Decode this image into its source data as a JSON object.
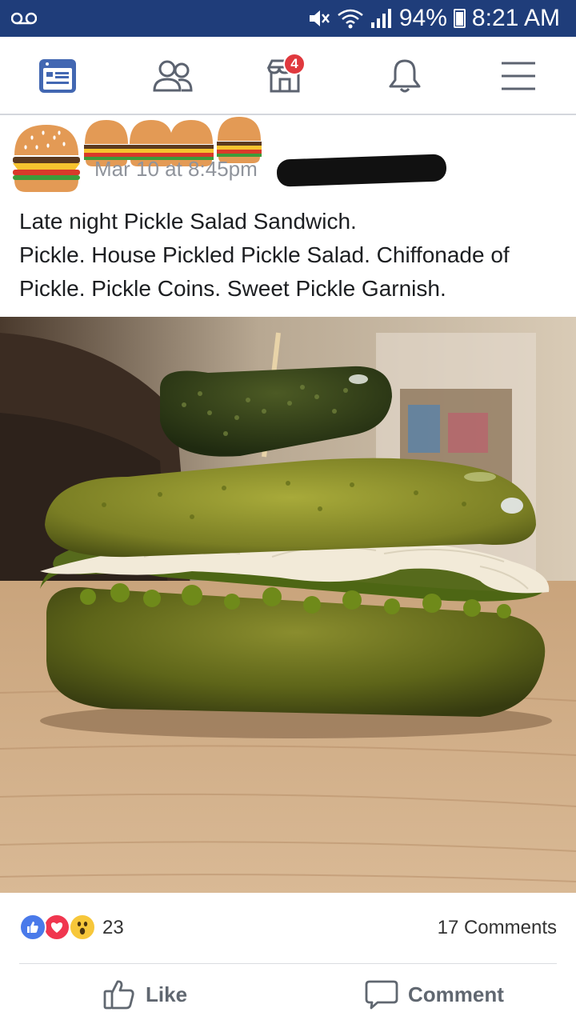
{
  "status_bar": {
    "battery_percent": "94%",
    "time": "8:21 AM"
  },
  "nav": {
    "items": [
      "news-feed",
      "friends",
      "marketplace",
      "notifications",
      "menu"
    ],
    "marketplace_badge": "4"
  },
  "post": {
    "timestamp": "Mar 10 at 8:45pm",
    "text_line1": "Late night Pickle Salad Sandwich.",
    "text_line2": "Pickle. House Pickled Pickle Salad. Chiffonade of Pickle. Pickle Coins. Sweet Pickle Garnish."
  },
  "reactions": {
    "count": "23",
    "comments": "17 Comments",
    "types": [
      "like",
      "love",
      "wow"
    ]
  },
  "actions": {
    "like_label": "Like",
    "comment_label": "Comment"
  },
  "colors": {
    "status_bar": "#1f3d7a",
    "accent_blue": "#4267b2",
    "badge_red": "#e0393e"
  }
}
